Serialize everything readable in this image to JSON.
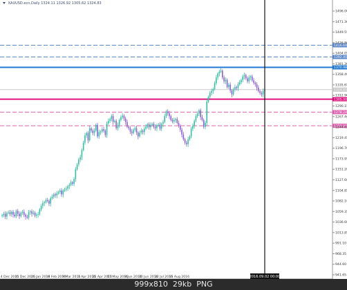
{
  "header": {
    "symbol": "XAUUSD.ecn",
    "timeframe": "Daily",
    "ohlc": "1324.11 1326.92 1305.62 1324.83"
  },
  "chart_data": {
    "type": "candlestick",
    "title": "",
    "y_ticks": [
      "1496.00",
      "1471.30",
      "1449.55",
      "1426.80",
      "1404.05",
      "1381.30",
      "1358.40",
      "1335.65",
      "1312.90",
      "1290.15",
      "1267.40",
      "1244.65",
      "1219.45",
      "1196.70",
      "1173.95",
      "1151.20",
      "1127.60",
      "1104.85",
      "1082.10",
      "1059.35",
      "1036.60",
      "1013.85",
      "991.10",
      "968.35",
      "944.60",
      "941.65"
    ],
    "x_ticks": [
      "4 Dec 2015",
      "31 Dec 2015",
      "26 Jan 2016",
      "18 Feb 2016",
      "9 Mar 2016",
      "1 Apr 2016",
      "25 Apr 2016",
      "17 May 2016",
      "8 Jun 2016",
      "30 Jun 2016",
      "22 Jul 2016",
      "15 Aug 2016"
    ],
    "price_levels": [
      {
        "label": "1416.69",
        "value": 1416.69,
        "color": "#5b86c8",
        "style": "dashed"
      },
      {
        "label": "1392.40",
        "value": 1392.4,
        "color": "#5b86c8",
        "style": "dashed"
      },
      {
        "label": "1370.98",
        "value": 1370.98,
        "color": "#1f78d1",
        "style": "solid"
      },
      {
        "label": "1324.83",
        "value": 1324.83,
        "color": "#c8c8c8",
        "style": "solid"
      },
      {
        "label": "1305.00",
        "value": 1305.0,
        "color": "#e0107f",
        "style": "solid"
      },
      {
        "label": "1278.24",
        "value": 1278.24,
        "color": "#e060b0",
        "style": "dashed"
      },
      {
        "label": "1250.00",
        "value": 1250.0,
        "color": "#e060b0",
        "style": "dashed"
      }
    ],
    "crosshair_date": "2016.09.02 00:00",
    "ylim": [
      941.65,
      1496.0
    ],
    "candles": [
      1065,
      1068,
      1062,
      1070,
      1071,
      1067,
      1072,
      1066,
      1063,
      1074,
      1068,
      1063,
      1070,
      1072,
      1066,
      1062,
      1060,
      1071,
      1073,
      1068,
      1070,
      1064,
      1066,
      1067,
      1077,
      1084,
      1090,
      1092,
      1096,
      1095,
      1089,
      1100,
      1103,
      1108,
      1106,
      1110,
      1113,
      1116,
      1108,
      1116,
      1118,
      1120,
      1125,
      1128,
      1133,
      1130,
      1140,
      1160,
      1170,
      1180,
      1185,
      1200,
      1215,
      1230,
      1235,
      1220,
      1245,
      1240,
      1235,
      1240,
      1252,
      1228,
      1237,
      1238,
      1243,
      1240,
      1231,
      1255,
      1260,
      1264,
      1270,
      1258,
      1260,
      1245,
      1252,
      1262,
      1268,
      1271,
      1265,
      1258,
      1248,
      1245,
      1238,
      1235,
      1242,
      1245,
      1236,
      1228,
      1236,
      1240,
      1237,
      1244,
      1248,
      1253,
      1247,
      1252,
      1254,
      1248,
      1245,
      1251,
      1252,
      1244,
      1254,
      1258,
      1270,
      1280,
      1276,
      1270,
      1262,
      1259,
      1262,
      1264,
      1256,
      1250,
      1242,
      1232,
      1222,
      1215,
      1212,
      1222,
      1228,
      1244,
      1250,
      1260,
      1270,
      1275,
      1282,
      1268,
      1262,
      1248,
      1256,
      1300,
      1310,
      1318,
      1322,
      1326,
      1338,
      1350,
      1358,
      1362,
      1364,
      1350,
      1342,
      1345,
      1330,
      1335,
      1323,
      1315,
      1325,
      1330,
      1328,
      1336,
      1340,
      1345,
      1352,
      1355,
      1348,
      1342,
      1350,
      1352,
      1344,
      1339,
      1336,
      1329,
      1322,
      1318,
      1315,
      1322,
      1324
    ]
  }
}
